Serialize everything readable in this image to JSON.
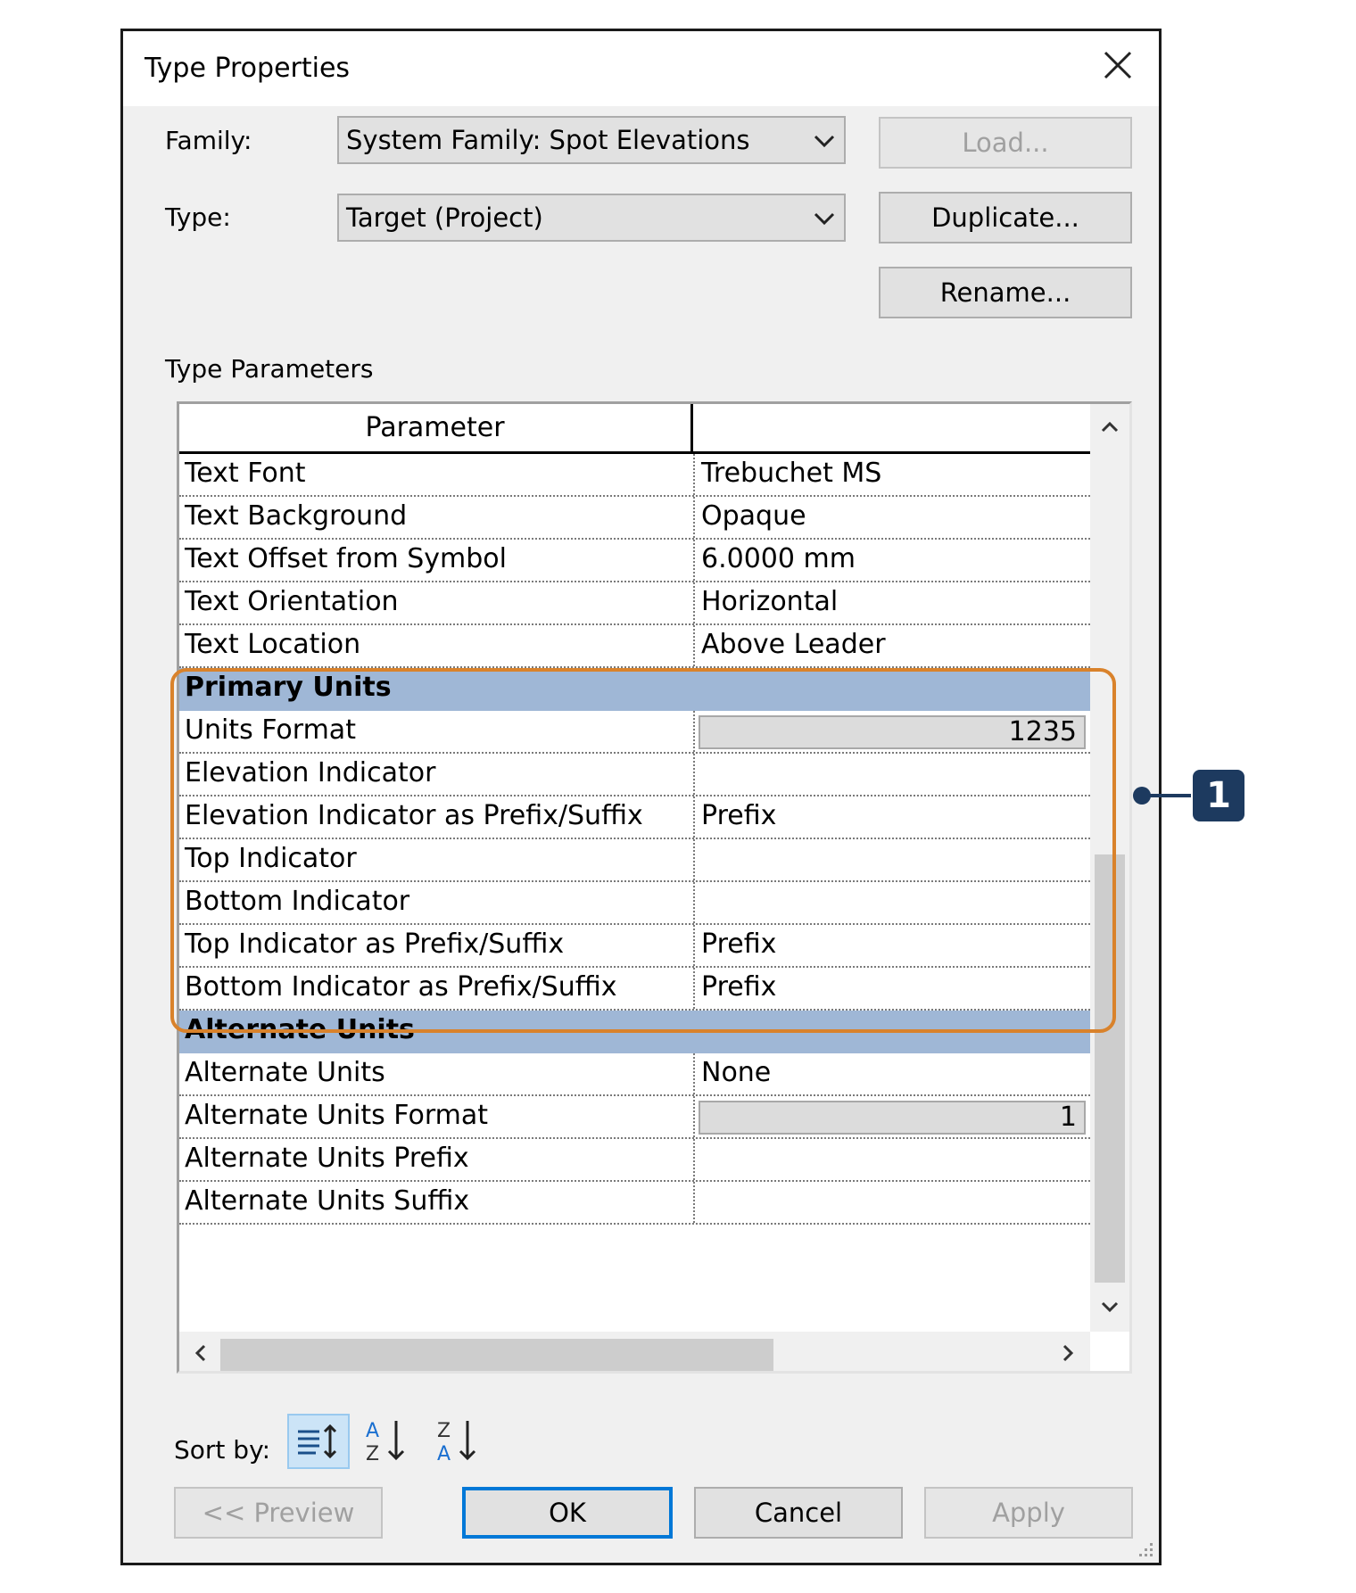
{
  "dialog": {
    "title": "Type Properties",
    "family_label": "Family:",
    "family_value": "System Family: Spot Elevations",
    "type_label": "Type:",
    "type_value": "Target (Project)",
    "load_button": "Load...",
    "duplicate_button": "Duplicate...",
    "rename_button": "Rename...",
    "type_parameters_label": "Type Parameters"
  },
  "grid": {
    "header_parameter": "Parameter",
    "header_value": "",
    "rows": [
      {
        "param": "Text Font",
        "value": "Trebuchet MS"
      },
      {
        "param": "Text Background",
        "value": "Opaque"
      },
      {
        "param": "Text Offset from Symbol",
        "value": "6.0000 mm"
      },
      {
        "param": "Text Orientation",
        "value": "Horizontal"
      },
      {
        "param": "Text Location",
        "value": "Above Leader"
      }
    ],
    "primary_group": "Primary Units",
    "primary_rows": [
      {
        "param": "Units Format",
        "value": "1235"
      },
      {
        "param": "Elevation Indicator",
        "value": ""
      },
      {
        "param": "Elevation Indicator as Prefix/Suffix",
        "value": "Prefix"
      },
      {
        "param": "Top Indicator",
        "value": ""
      },
      {
        "param": "Bottom Indicator",
        "value": ""
      },
      {
        "param": "Top Indicator as Prefix/Suffix",
        "value": "Prefix"
      },
      {
        "param": "Bottom Indicator as Prefix/Suffix",
        "value": "Prefix"
      }
    ],
    "alternate_group": "Alternate Units",
    "alternate_rows": [
      {
        "param": "Alternate Units",
        "value": "None"
      },
      {
        "param": "Alternate Units Format",
        "value": "1"
      },
      {
        "param": "Alternate Units Prefix",
        "value": ""
      },
      {
        "param": "Alternate Units Suffix",
        "value": ""
      }
    ]
  },
  "sort": {
    "label": "Sort by:",
    "icons": [
      "grouped-sort-icon",
      "sort-a-to-z-icon",
      "sort-z-to-a-icon"
    ],
    "a_letter": "A",
    "z_letter": "Z"
  },
  "footer": {
    "preview_button": "<< Preview",
    "ok_button": "OK",
    "cancel_button": "Cancel",
    "apply_button": "Apply"
  },
  "callout": {
    "number": "1",
    "color": "#1d3a5f",
    "highlight_color": "#d9822b"
  },
  "colors": {
    "group_header": "#9fb7d6",
    "default_button_border": "#0078d7"
  }
}
